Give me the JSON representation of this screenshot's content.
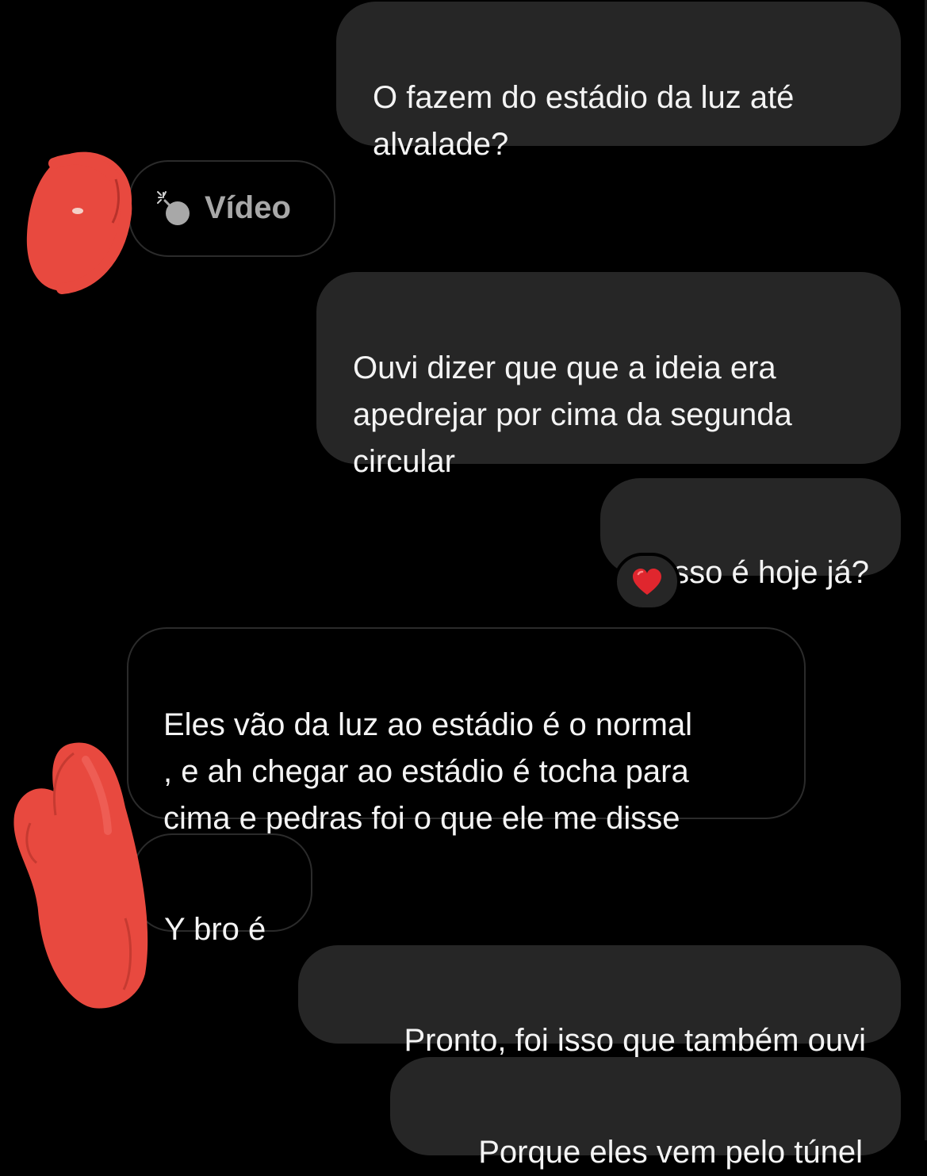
{
  "messages": [
    {
      "direction": "sent",
      "text": "O fazem do estádio da luz até\nalvalade?"
    },
    {
      "direction": "received",
      "type": "video",
      "label": "Vídeo",
      "icon": "video-bomb-icon"
    },
    {
      "direction": "sent",
      "text": "Ouvi dizer que que a ideia era\napedrejar por cima da segunda\ncircular"
    },
    {
      "direction": "sent",
      "text": "Isso é hoje já?",
      "reaction": {
        "emoji": "❤️",
        "icon": "red-heart-icon"
      }
    },
    {
      "direction": "received",
      "text": "Eles vão da luz ao estádio é o normal\n, e ah chegar ao estádio é tocha para\ncima e pedras foi o que ele me disse"
    },
    {
      "direction": "received",
      "text": "Y bro é"
    },
    {
      "direction": "sent",
      "text": "Pronto, foi isso que também ouvi"
    },
    {
      "direction": "sent",
      "text": "Porque eles vem pelo túnel"
    }
  ],
  "colors": {
    "background": "#000000",
    "sent_bubble": "#262626",
    "received_border": "#2b2b2b",
    "text": "#f4f4f4",
    "redaction": "#e8493f"
  },
  "redactions": [
    {
      "name": "redacted-avatar-1",
      "color": "#e8493f"
    },
    {
      "name": "redacted-avatar-2",
      "color": "#e8493f"
    }
  ]
}
